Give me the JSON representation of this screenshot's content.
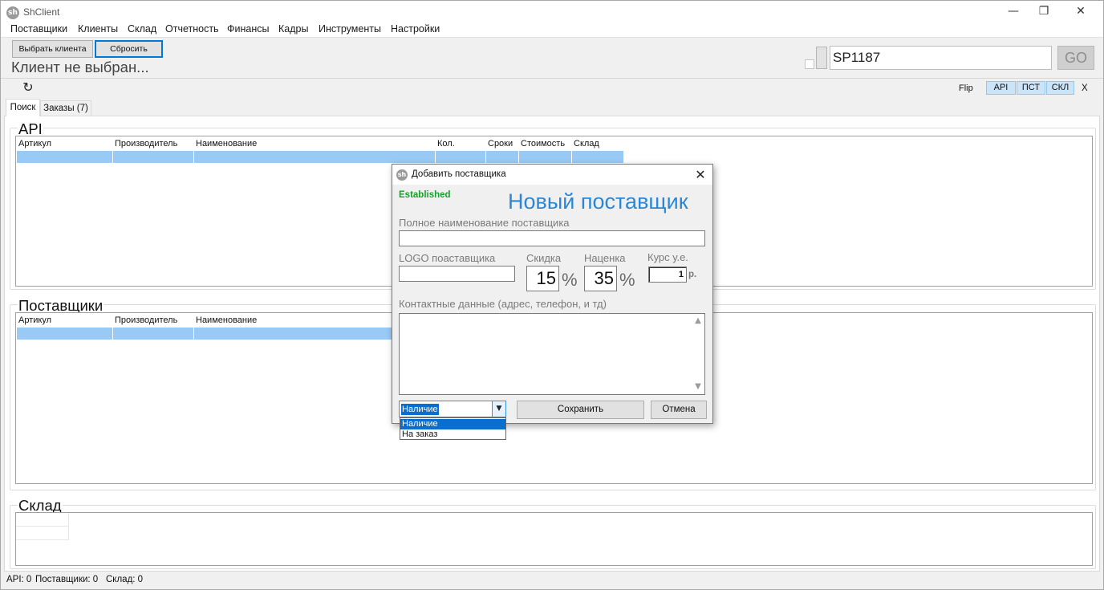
{
  "window": {
    "app_icon": "sh",
    "title": "ShClient",
    "controls": {
      "minimize": "—",
      "restore": "❐",
      "close": "✕"
    }
  },
  "menu": [
    "Поставщики",
    "Клиенты",
    "Склад",
    "Отчетность",
    "Финансы",
    "Кадры",
    "Инструменты",
    "Настройки"
  ],
  "client_bar": {
    "select_client": "Выбрать клиента",
    "reset": "Сбросить",
    "status": "Клиент не выбран...",
    "search_value": "SP1187",
    "go": "GO"
  },
  "toolbar": {
    "refresh_glyph": "↻",
    "flip": "Flip",
    "filters": [
      "API",
      "ПСТ",
      "СКЛ"
    ],
    "close": "X"
  },
  "tabs": [
    "Поиск",
    "Заказы (7)"
  ],
  "sections": {
    "api": {
      "title": "API",
      "columns": [
        "Артикул",
        "Производитель",
        "Наименование",
        "Кол.",
        "Сроки",
        "Стоимость",
        "Склад"
      ]
    },
    "suppliers": {
      "title": "Поставщики",
      "columns": [
        "Артикул",
        "Производитель",
        "Наименование"
      ]
    },
    "warehouse": {
      "title": "Склад"
    }
  },
  "status_bar": {
    "api": "API: 0",
    "suppliers": "Поставщики: 0",
    "warehouse": "Склад: 0"
  },
  "dialog": {
    "icon": "sh",
    "title": "Добавить поставщика",
    "close": "✕",
    "badge": "Established",
    "heading": "Новый поставщик",
    "full_name_label": "Полное наименование поставщика",
    "full_name_value": "",
    "logo_label": "LOGO поаставщика",
    "logo_value": "",
    "discount_label": "Скидка",
    "discount_value": "15",
    "markup_label": "Наценка",
    "markup_value": "35",
    "percent": "%",
    "rate_label": "Курс у.е.",
    "rate_value": "1",
    "rate_unit": "р.",
    "contacts_label": "Контактные данные (адрес, телефон, и тд)",
    "contacts_value": "",
    "availability_selected": "Наличие",
    "availability_options": [
      "Наличие",
      "На заказ"
    ],
    "save": "Сохранить",
    "cancel": "Отмена"
  }
}
